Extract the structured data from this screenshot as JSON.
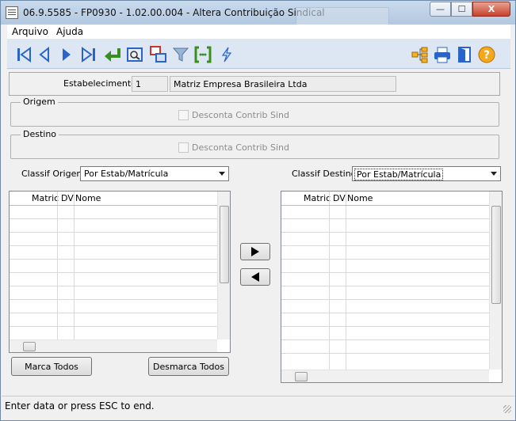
{
  "window": {
    "title": "06.9.5585 - FP0930 - 1.02.00.004 - Altera Contribuição Sindical",
    "min_label": "—",
    "max_label": "☐",
    "close_label": "X"
  },
  "menu": {
    "items": [
      "Arquivo",
      "Ajuda"
    ]
  },
  "toolbar": {
    "left_icons": [
      "first-record-icon",
      "previous-record-icon",
      "next-record-icon",
      "last-record-icon",
      "enter-icon",
      "zoom-icon",
      "relations-icon",
      "filter-icon",
      "brackets-icon",
      "lightning-icon"
    ],
    "right_icons": [
      "tree-icon",
      "print-icon",
      "exit-icon",
      "help-icon"
    ]
  },
  "estabelecimento": {
    "label": "Estabelecimento:",
    "code": "1",
    "name": "Matriz Empresa Brasileira Ltda"
  },
  "origem": {
    "title": "Origem",
    "checkbox_label": "Desconta Contrib Sind"
  },
  "destino": {
    "title": "Destino",
    "checkbox_label": "Desconta Contrib Sind"
  },
  "classif_origem": {
    "label": "Classif Origem:",
    "value": "Por Estab/Matrícula"
  },
  "classif_destino": {
    "label": "Classif Destino:",
    "value": "Por Estab/Matrícula"
  },
  "grid_left": {
    "columns": [
      "Matric",
      "DV",
      "Nome"
    ]
  },
  "grid_right": {
    "columns": [
      "Matric",
      "DV",
      "Nome"
    ]
  },
  "buttons": {
    "move_right": "▶",
    "move_left": "◀",
    "mark_all": "Marca Todos",
    "unmark_all": "Desmarca Todos"
  },
  "status": {
    "text": "Enter data or press ESC to end."
  },
  "colors": {
    "accent": "#1f5fbf",
    "titlebar": "#b3c8e0",
    "toolbar": "#dde7f3"
  }
}
